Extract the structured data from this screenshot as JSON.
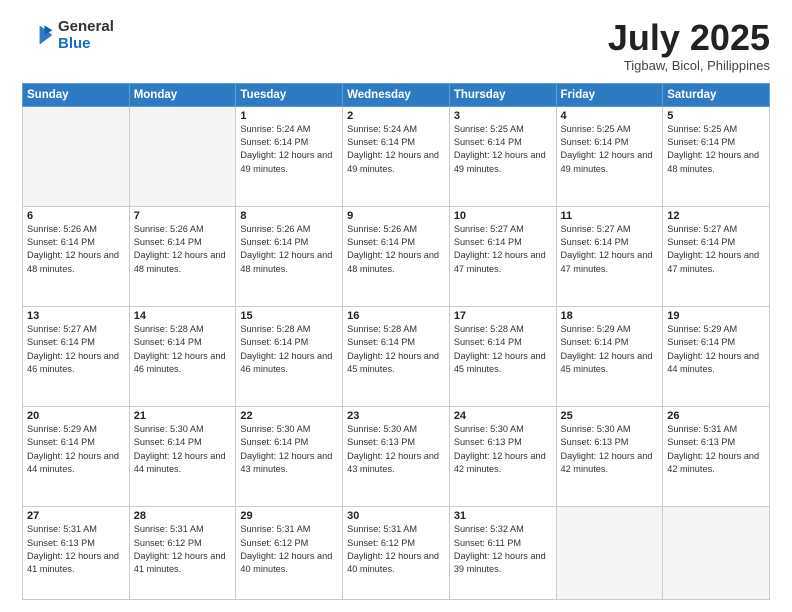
{
  "header": {
    "logo_general": "General",
    "logo_blue": "Blue",
    "month": "July 2025",
    "location": "Tigbaw, Bicol, Philippines"
  },
  "days_of_week": [
    "Sunday",
    "Monday",
    "Tuesday",
    "Wednesday",
    "Thursday",
    "Friday",
    "Saturday"
  ],
  "weeks": [
    [
      {
        "day": "",
        "info": ""
      },
      {
        "day": "",
        "info": ""
      },
      {
        "day": "1",
        "info": "Sunrise: 5:24 AM\nSunset: 6:14 PM\nDaylight: 12 hours and 49 minutes."
      },
      {
        "day": "2",
        "info": "Sunrise: 5:24 AM\nSunset: 6:14 PM\nDaylight: 12 hours and 49 minutes."
      },
      {
        "day": "3",
        "info": "Sunrise: 5:25 AM\nSunset: 6:14 PM\nDaylight: 12 hours and 49 minutes."
      },
      {
        "day": "4",
        "info": "Sunrise: 5:25 AM\nSunset: 6:14 PM\nDaylight: 12 hours and 49 minutes."
      },
      {
        "day": "5",
        "info": "Sunrise: 5:25 AM\nSunset: 6:14 PM\nDaylight: 12 hours and 48 minutes."
      }
    ],
    [
      {
        "day": "6",
        "info": "Sunrise: 5:26 AM\nSunset: 6:14 PM\nDaylight: 12 hours and 48 minutes."
      },
      {
        "day": "7",
        "info": "Sunrise: 5:26 AM\nSunset: 6:14 PM\nDaylight: 12 hours and 48 minutes."
      },
      {
        "day": "8",
        "info": "Sunrise: 5:26 AM\nSunset: 6:14 PM\nDaylight: 12 hours and 48 minutes."
      },
      {
        "day": "9",
        "info": "Sunrise: 5:26 AM\nSunset: 6:14 PM\nDaylight: 12 hours and 48 minutes."
      },
      {
        "day": "10",
        "info": "Sunrise: 5:27 AM\nSunset: 6:14 PM\nDaylight: 12 hours and 47 minutes."
      },
      {
        "day": "11",
        "info": "Sunrise: 5:27 AM\nSunset: 6:14 PM\nDaylight: 12 hours and 47 minutes."
      },
      {
        "day": "12",
        "info": "Sunrise: 5:27 AM\nSunset: 6:14 PM\nDaylight: 12 hours and 47 minutes."
      }
    ],
    [
      {
        "day": "13",
        "info": "Sunrise: 5:27 AM\nSunset: 6:14 PM\nDaylight: 12 hours and 46 minutes."
      },
      {
        "day": "14",
        "info": "Sunrise: 5:28 AM\nSunset: 6:14 PM\nDaylight: 12 hours and 46 minutes."
      },
      {
        "day": "15",
        "info": "Sunrise: 5:28 AM\nSunset: 6:14 PM\nDaylight: 12 hours and 46 minutes."
      },
      {
        "day": "16",
        "info": "Sunrise: 5:28 AM\nSunset: 6:14 PM\nDaylight: 12 hours and 45 minutes."
      },
      {
        "day": "17",
        "info": "Sunrise: 5:28 AM\nSunset: 6:14 PM\nDaylight: 12 hours and 45 minutes."
      },
      {
        "day": "18",
        "info": "Sunrise: 5:29 AM\nSunset: 6:14 PM\nDaylight: 12 hours and 45 minutes."
      },
      {
        "day": "19",
        "info": "Sunrise: 5:29 AM\nSunset: 6:14 PM\nDaylight: 12 hours and 44 minutes."
      }
    ],
    [
      {
        "day": "20",
        "info": "Sunrise: 5:29 AM\nSunset: 6:14 PM\nDaylight: 12 hours and 44 minutes."
      },
      {
        "day": "21",
        "info": "Sunrise: 5:30 AM\nSunset: 6:14 PM\nDaylight: 12 hours and 44 minutes."
      },
      {
        "day": "22",
        "info": "Sunrise: 5:30 AM\nSunset: 6:14 PM\nDaylight: 12 hours and 43 minutes."
      },
      {
        "day": "23",
        "info": "Sunrise: 5:30 AM\nSunset: 6:13 PM\nDaylight: 12 hours and 43 minutes."
      },
      {
        "day": "24",
        "info": "Sunrise: 5:30 AM\nSunset: 6:13 PM\nDaylight: 12 hours and 42 minutes."
      },
      {
        "day": "25",
        "info": "Sunrise: 5:30 AM\nSunset: 6:13 PM\nDaylight: 12 hours and 42 minutes."
      },
      {
        "day": "26",
        "info": "Sunrise: 5:31 AM\nSunset: 6:13 PM\nDaylight: 12 hours and 42 minutes."
      }
    ],
    [
      {
        "day": "27",
        "info": "Sunrise: 5:31 AM\nSunset: 6:13 PM\nDaylight: 12 hours and 41 minutes."
      },
      {
        "day": "28",
        "info": "Sunrise: 5:31 AM\nSunset: 6:12 PM\nDaylight: 12 hours and 41 minutes."
      },
      {
        "day": "29",
        "info": "Sunrise: 5:31 AM\nSunset: 6:12 PM\nDaylight: 12 hours and 40 minutes."
      },
      {
        "day": "30",
        "info": "Sunrise: 5:31 AM\nSunset: 6:12 PM\nDaylight: 12 hours and 40 minutes."
      },
      {
        "day": "31",
        "info": "Sunrise: 5:32 AM\nSunset: 6:11 PM\nDaylight: 12 hours and 39 minutes."
      },
      {
        "day": "",
        "info": ""
      },
      {
        "day": "",
        "info": ""
      }
    ]
  ]
}
